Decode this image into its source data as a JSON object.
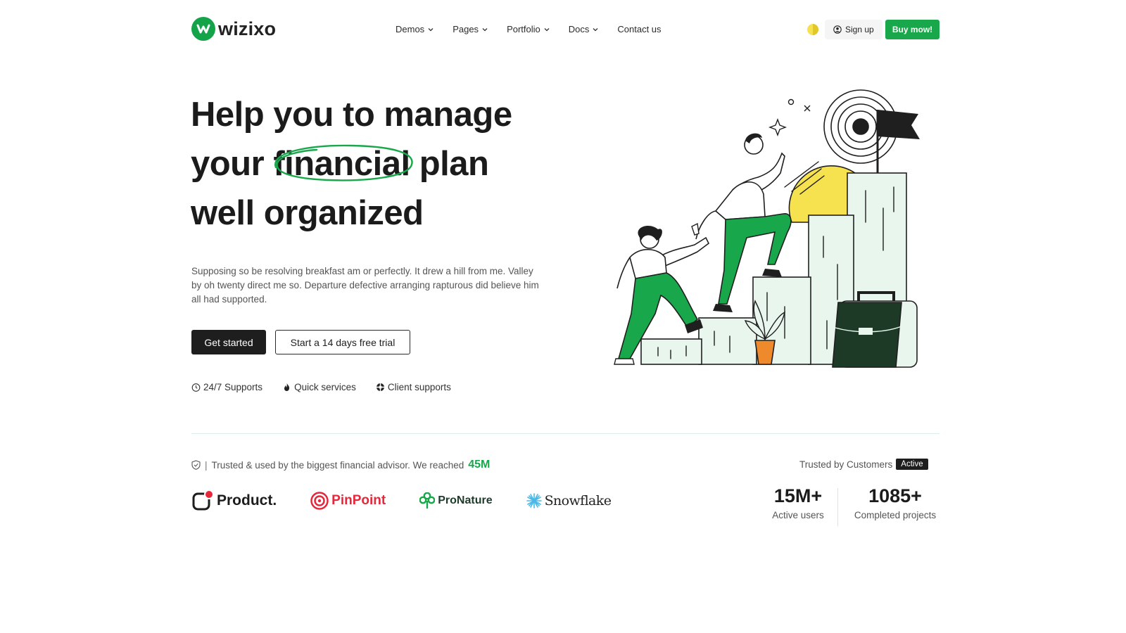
{
  "header": {
    "logo_text": "wizixo",
    "nav": [
      {
        "label": "Demos",
        "dropdown": true
      },
      {
        "label": "Pages",
        "dropdown": true
      },
      {
        "label": "Portfolio",
        "dropdown": true
      },
      {
        "label": "Docs",
        "dropdown": true
      },
      {
        "label": "Contact us",
        "dropdown": false
      }
    ],
    "theme_icon": "half-moon-theme-icon",
    "signup_label": "Sign up",
    "buy_label": "Buy mow!"
  },
  "hero": {
    "title_line1": "Help you to manage",
    "title_line2_pre": "your",
    "title_highlight": "financial",
    "title_line2_post": "plan",
    "title_line3": "well organized",
    "description": "Supposing so be resolving breakfast am or perfectly. It drew a hill from me. Valley by oh twenty direct me so. Departure defective arranging rapturous did believe him all had supported.",
    "primary_cta": "Get started",
    "secondary_cta": "Start a 14 days free trial",
    "features": [
      {
        "icon": "clock-icon",
        "label": "24/7 Supports"
      },
      {
        "icon": "flame-icon",
        "label": "Quick services"
      },
      {
        "icon": "lifebuoy-icon",
        "label": "Client supports"
      }
    ]
  },
  "trusted": {
    "text": "Trusted & used by the biggest financial advisor. We reached",
    "reach": "45M",
    "customers_label": "Trusted by Customers",
    "badge": "Active",
    "brands": [
      {
        "name": "Product."
      },
      {
        "name": "PinPoint"
      },
      {
        "name": "ProNature"
      },
      {
        "name": "Snowflake"
      }
    ]
  },
  "stats": [
    {
      "value": "15M+",
      "label": "Active users"
    },
    {
      "value": "1085+",
      "label": "Completed projects"
    }
  ],
  "colors": {
    "accent": "#19a74b",
    "dark": "#1e1e1e",
    "pale_green": "#e9f6ee",
    "yellow": "#f6e24f",
    "orange": "#ef8a2c"
  }
}
